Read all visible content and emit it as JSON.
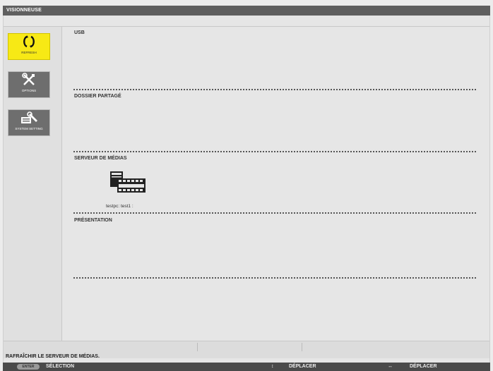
{
  "window": {
    "title": "VISIONNEUSE"
  },
  "sidebar": {
    "refresh_label": "REFRESH",
    "options_label": "OPTIONS",
    "system_label": "SYSTEM SETTING"
  },
  "sections": {
    "usb": "USB",
    "shared_folder": "DOSSIER PARTAGÉ",
    "media_server": "SERVEUR DE MÉDIAS",
    "presentation": "PRÉSENTATION"
  },
  "media_server": {
    "item_label": "testpc: test1 :"
  },
  "status": {
    "message": "RAFRAÎCHIR LE SERVEUR DE MÉDIAS."
  },
  "footer": {
    "enter_key": "ENTER",
    "select_label": "SÉLECTION",
    "up_down_glyph": "↕",
    "move_label_1": "DÉPLACER",
    "left_right_glyph": "↔",
    "move_label_2": "DÉPLACER"
  },
  "colors": {
    "accent_selected": "#f7e915",
    "button_default": "#6e6e6e",
    "title_bar": "#5f5f5f"
  },
  "icons": {
    "refresh": "refresh-icon",
    "options": "tools-icon",
    "system": "system-setting-icon",
    "media": "media-file-icon"
  }
}
